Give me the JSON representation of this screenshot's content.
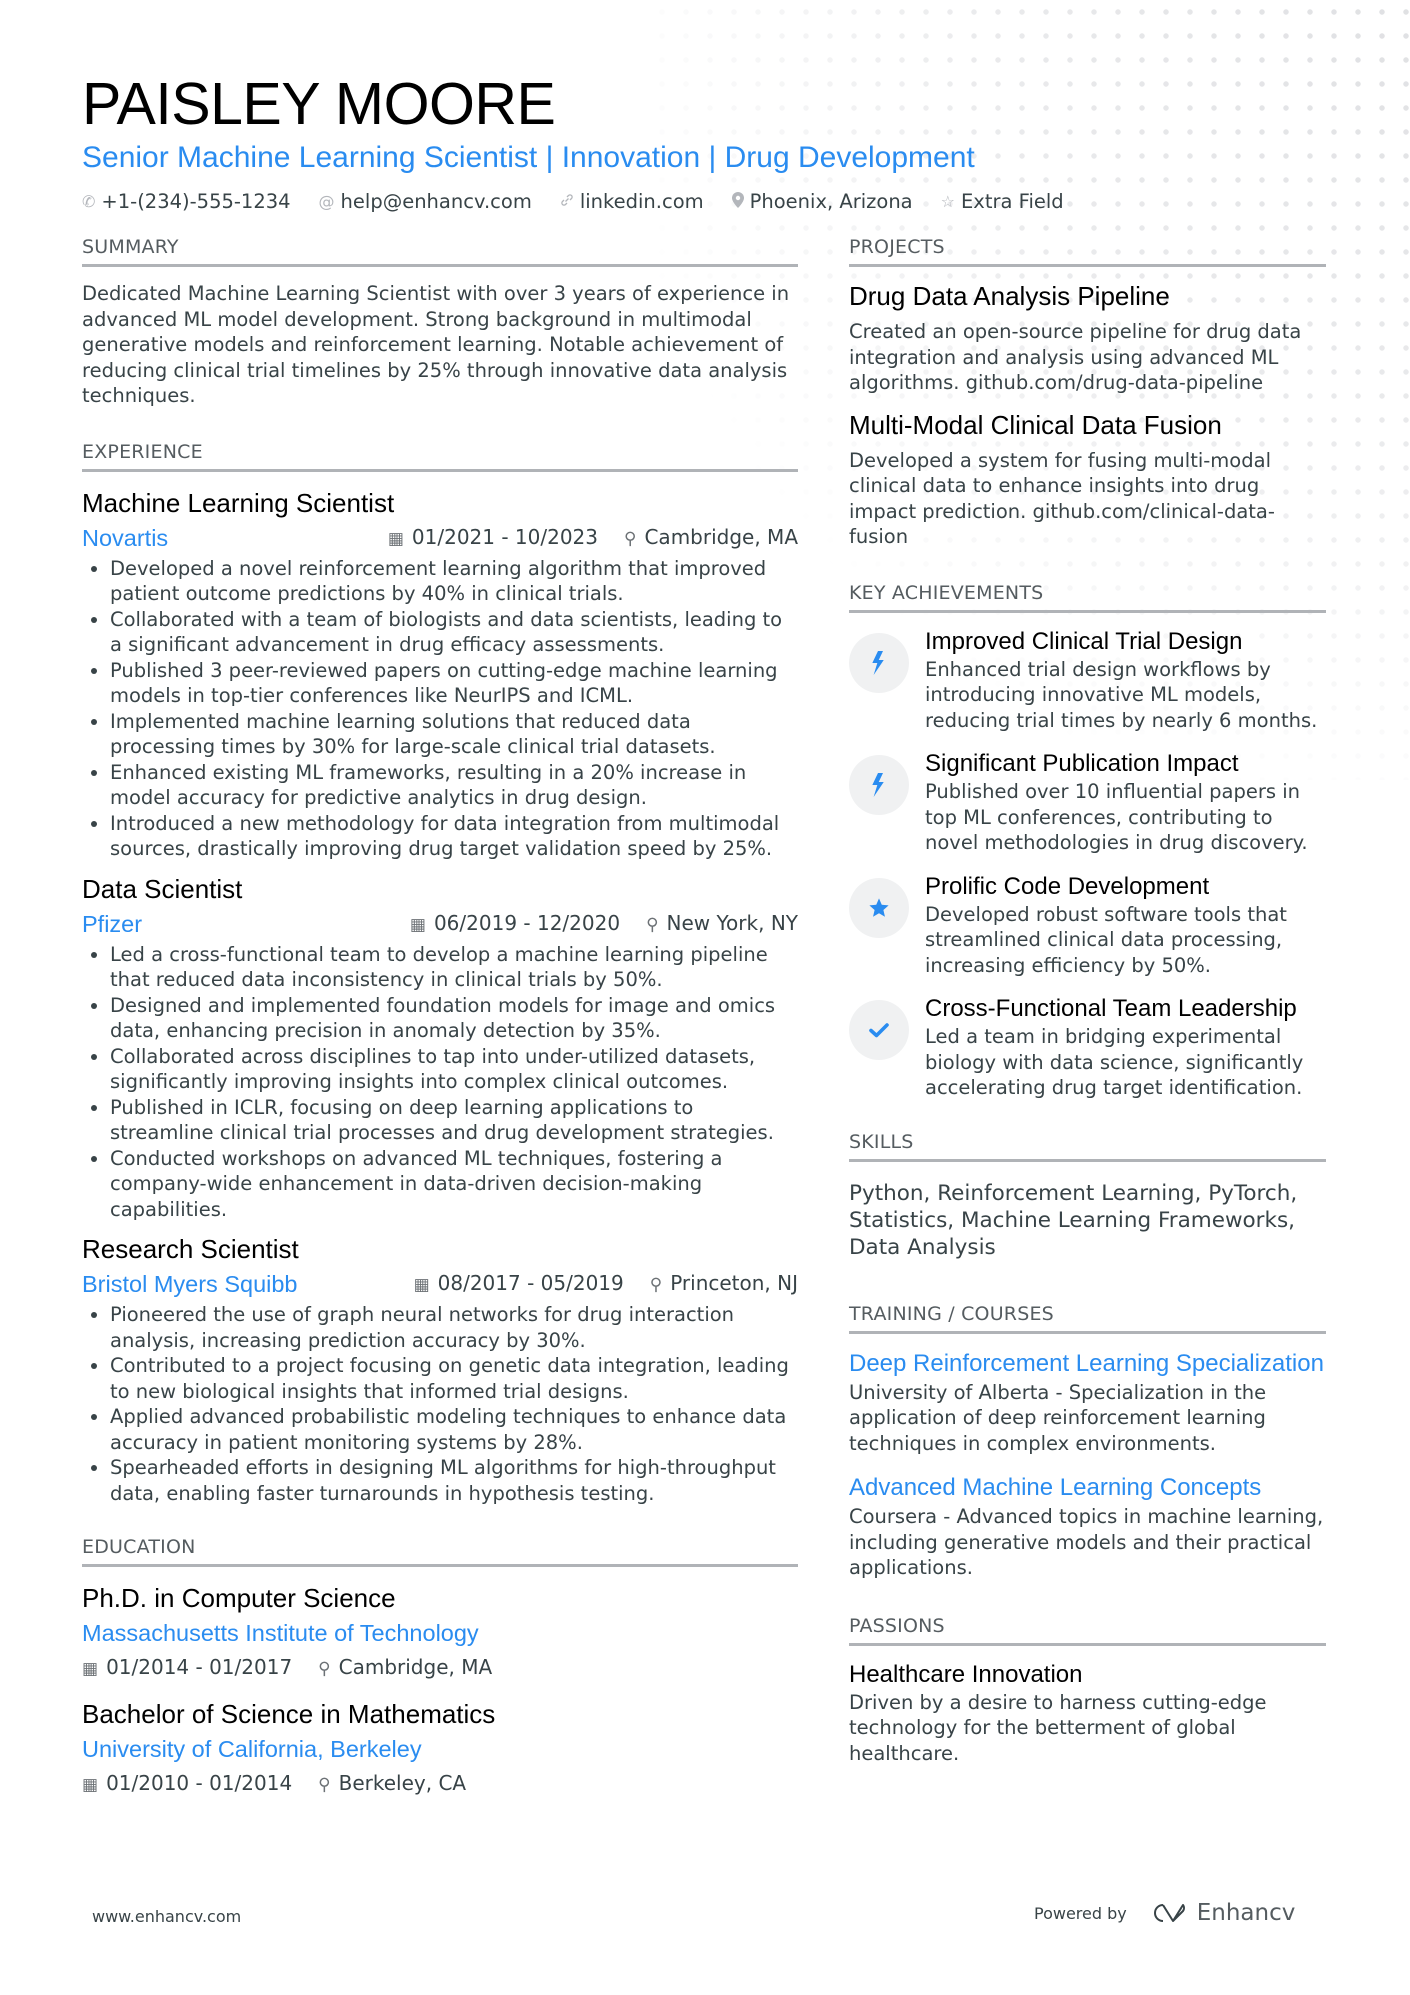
{
  "header": {
    "name": "PAISLEY MOORE",
    "title": "Senior Machine Learning Scientist | Innovation | Drug Development",
    "contacts": [
      {
        "icon": "phone-icon",
        "glyph": "✆",
        "text": "+1-(234)-555-1234"
      },
      {
        "icon": "at-icon",
        "glyph": "@",
        "text": "help@enhancv.com"
      },
      {
        "icon": "link-icon",
        "glyph": "🔗",
        "text": "linkedin.com"
      },
      {
        "icon": "location-pin-icon",
        "glyph": "⚲",
        "text": "Phoenix, Arizona"
      },
      {
        "icon": "star-outline-icon",
        "glyph": "☆",
        "text": "Extra Field"
      }
    ]
  },
  "summary": {
    "heading": "SUMMARY",
    "text": "Dedicated Machine Learning Scientist with over 3 years of experience in advanced ML model development. Strong background in multimodal generative models and reinforcement learning. Notable achievement of reducing clinical trial timelines by 25% through innovative data analysis techniques."
  },
  "experience": {
    "heading": "EXPERIENCE",
    "jobs": [
      {
        "title": "Machine Learning Scientist",
        "company": "Novartis",
        "dates": "01/2021 - 10/2023",
        "location": "Cambridge, MA",
        "bullets": [
          "Developed a novel reinforcement learning algorithm that improved patient outcome predictions by 40% in clinical trials.",
          "Collaborated with a team of biologists and data scientists, leading to a significant advancement in drug efficacy assessments.",
          "Published 3 peer-reviewed papers on cutting-edge machine learning models in top-tier conferences like NeurIPS and ICML.",
          "Implemented machine learning solutions that reduced data processing times by 30% for large-scale clinical trial datasets.",
          "Enhanced existing ML frameworks, resulting in a 20% increase in model accuracy for predictive analytics in drug design.",
          "Introduced a new methodology for data integration from multimodal sources, drastically improving drug target validation speed by 25%."
        ]
      },
      {
        "title": "Data Scientist",
        "company": "Pfizer",
        "dates": "06/2019 - 12/2020",
        "location": "New York, NY",
        "bullets": [
          "Led a cross-functional team to develop a machine learning pipeline that reduced data inconsistency in clinical trials by 50%.",
          "Designed and implemented foundation models for image and omics data, enhancing precision in anomaly detection by 35%.",
          "Collaborated across disciplines to tap into under-utilized datasets, significantly improving insights into complex clinical outcomes.",
          "Published in ICLR, focusing on deep learning applications to streamline clinical trial processes and drug development strategies.",
          "Conducted workshops on advanced ML techniques, fostering a company-wide enhancement in data-driven decision-making capabilities."
        ]
      },
      {
        "title": "Research Scientist",
        "company": "Bristol Myers Squibb",
        "dates": "08/2017 - 05/2019",
        "location": "Princeton, NJ",
        "bullets": [
          "Pioneered the use of graph neural networks for drug interaction analysis, increasing prediction accuracy by 30%.",
          "Contributed to a project focusing on genetic data integration, leading to new biological insights that informed trial designs.",
          "Applied advanced probabilistic modeling techniques to enhance data accuracy in patient monitoring systems by 28%.",
          "Spearheaded efforts in designing ML algorithms for high-throughput data, enabling faster turnarounds in hypothesis testing."
        ]
      }
    ]
  },
  "education": {
    "heading": "EDUCATION",
    "items": [
      {
        "degree": "Ph.D. in Computer Science",
        "school": "Massachusetts Institute of Technology",
        "dates": "01/2014 - 01/2017",
        "location": "Cambridge, MA"
      },
      {
        "degree": "Bachelor of Science in Mathematics",
        "school": "University of California, Berkeley",
        "dates": "01/2010 - 01/2014",
        "location": "Berkeley, CA"
      }
    ]
  },
  "projects": {
    "heading": "PROJECTS",
    "items": [
      {
        "title": "Drug Data Analysis Pipeline",
        "desc": "Created an open-source pipeline for drug data integration and analysis using advanced ML algorithms. github.com/drug-data-pipeline"
      },
      {
        "title": "Multi-Modal Clinical Data Fusion",
        "desc": "Developed a system for fusing multi-modal clinical data to enhance insights into drug impact prediction. github.com/clinical-data-fusion"
      }
    ]
  },
  "achievements": {
    "heading": "KEY ACHIEVEMENTS",
    "items": [
      {
        "icon": "lightning-bolt-icon",
        "glyph": "ϟ",
        "title": "Improved Clinical Trial Design",
        "desc": "Enhanced trial design workflows by introducing innovative ML models, reducing trial times by nearly 6 months."
      },
      {
        "icon": "lightning-bolt-icon",
        "glyph": "ϟ",
        "title": "Significant Publication Impact",
        "desc": "Published over 10 influential papers in top ML conferences, contributing to novel methodologies in drug discovery."
      },
      {
        "icon": "star-icon",
        "glyph": "★",
        "title": "Prolific Code Development",
        "desc": "Developed robust software tools that streamlined clinical data processing, increasing efficiency by 50%."
      },
      {
        "icon": "checkmark-icon",
        "glyph": "✔",
        "title": "Cross-Functional Team Leadership",
        "desc": "Led a team in bridging experimental biology with data science, significantly accelerating drug target identification."
      }
    ]
  },
  "skills": {
    "heading": "SKILLS",
    "text": "Python, Reinforcement Learning, PyTorch, Statistics, Machine Learning Frameworks, Data Analysis"
  },
  "courses": {
    "heading": "TRAINING / COURSES",
    "items": [
      {
        "title": "Deep Reinforcement Learning Specialization",
        "desc": "University of Alberta - Specialization in the application of deep reinforcement learning techniques in complex environments."
      },
      {
        "title": "Advanced Machine Learning Concepts",
        "desc": "Coursera - Advanced topics in machine learning, including generative models and their practical applications."
      }
    ]
  },
  "passions": {
    "heading": "PASSIONS",
    "items": [
      {
        "title": "Healthcare Innovation",
        "desc": "Driven by a desire to harness cutting-edge technology for the betterment of global healthcare."
      }
    ]
  },
  "footer": {
    "website": "www.enhancv.com",
    "powered_by": "Powered by",
    "brand": "Enhancv"
  },
  "icons": {
    "calendar": "▦",
    "pin": "⚲"
  },
  "colors": {
    "accent": "#2a8cf0",
    "text": "#384347",
    "heading": "#000000",
    "rule": "#b0b3b7"
  }
}
